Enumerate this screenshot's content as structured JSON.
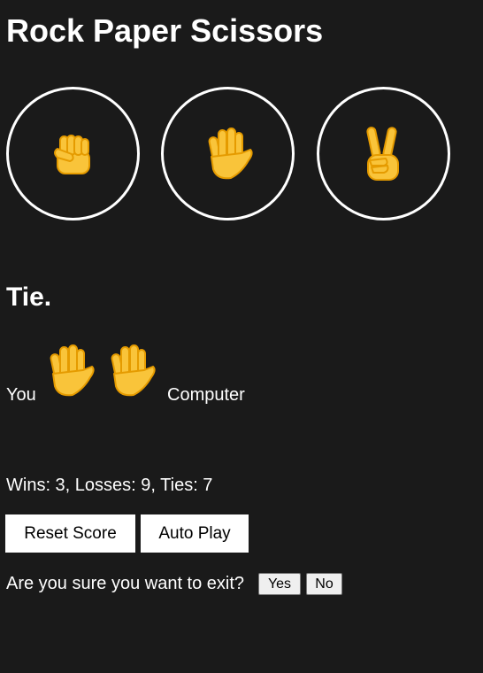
{
  "title": "Rock Paper Scissors",
  "choices": [
    {
      "name": "rock",
      "icon": "fist-icon"
    },
    {
      "name": "paper",
      "icon": "open-hand-icon"
    },
    {
      "name": "scissors",
      "icon": "victory-hand-icon"
    }
  ],
  "result": "Tie.",
  "moves": {
    "you_label": "You",
    "you_move_icon": "open-hand-icon",
    "computer_move_icon": "open-hand-icon",
    "computer_label": "Computer"
  },
  "score_text": "Wins: 3, Losses: 9, Ties: 7",
  "buttons": {
    "reset": "Reset Score",
    "auto_play": "Auto Play"
  },
  "confirm": {
    "text": "Are you sure you want to exit?",
    "yes": "Yes",
    "no": "No"
  },
  "colors": {
    "background": "#1a1a1a",
    "text": "#ffffff",
    "emoji_fill": "#f9c43a",
    "emoji_outline": "#e59b00"
  }
}
